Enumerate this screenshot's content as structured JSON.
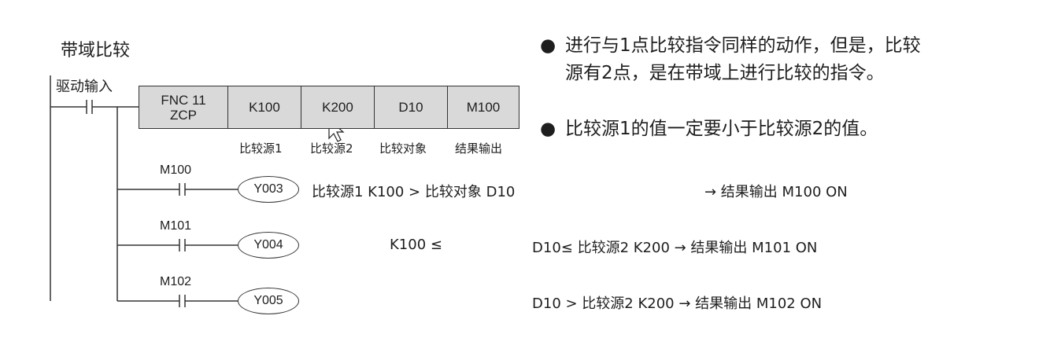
{
  "title": "带域比较",
  "drive_input": "驱动输入",
  "instruction": {
    "fnc": "FNC 11",
    "name": "ZCP",
    "operands": [
      "K100",
      "K200",
      "D10",
      "M100"
    ],
    "operand_labels": [
      "比较源1",
      "比较源2",
      "比较对象",
      "结果输出"
    ]
  },
  "rungs": [
    {
      "contact": "M100",
      "coil": "Y003"
    },
    {
      "contact": "M101",
      "coil": "Y004"
    },
    {
      "contact": "M102",
      "coil": "Y005"
    }
  ],
  "conditions": {
    "r1_left": "比较源1  K100 > 比较对象 D10",
    "r1_right": "→ 结果输出  M100 ON",
    "r2_left": "K100 ≤",
    "r2_right": "D10≤ 比较源2 K200 → 结果输出  M101 ON",
    "r3_right": "D10 > 比较源2 K200 → 结果输出  M102 ON"
  },
  "notes": [
    "进行与1点比较指令同样的动作，但是，比较",
    "源有2点，是在带域上进行比较的指令。",
    "比较源1的值一定要小于比较源2的值。"
  ]
}
